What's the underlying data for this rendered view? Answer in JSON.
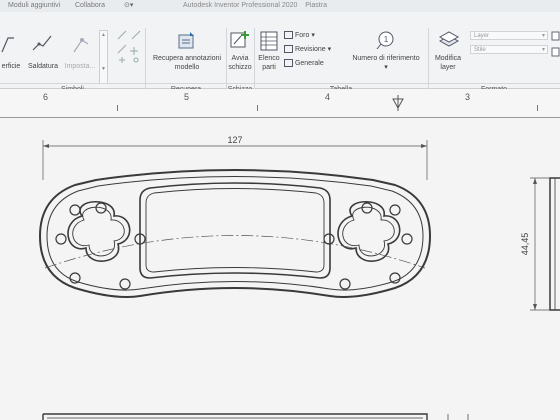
{
  "titlebar": {
    "tabs": [
      "Moduli aggiuntivi",
      "Collabora"
    ],
    "app_title": "Autodesk Inventor Professional 2020",
    "document": "Piastra"
  },
  "ribbon": {
    "simboli": {
      "group": "Simboli",
      "buttons": [
        "erficie",
        "Saldatura",
        "Imposta..."
      ]
    },
    "recupera": {
      "group": "Recupera",
      "button_line1": "Recupera annotazioni",
      "button_line2": "modello"
    },
    "schizzo": {
      "group": "Schizzo",
      "button_line1": "Avvia",
      "button_line2": "schizzo"
    },
    "tabella": {
      "group": "Tabella",
      "elenco_line1": "Elenco",
      "elenco_line2": "parti",
      "foro": "Foro",
      "revisione": "Revisione",
      "generale": "Generale",
      "numero": "Numero di riferimento"
    },
    "formato": {
      "group": "Formato",
      "modifica_line1": "Modifica",
      "modifica_line2": "layer",
      "layer_placeholder": "Layer",
      "stile_placeholder": "Stile"
    }
  },
  "ruler": {
    "numbers": [
      "6",
      "5",
      "4",
      "3"
    ]
  },
  "drawing": {
    "dim_width": "127",
    "dim_height": "44,45"
  },
  "colors": {
    "ribbon_bg": "#f1f3f5",
    "sheet_bg": "#f4f4f4",
    "line": "#3a3a3a",
    "accent_green": "#3a9a3a"
  }
}
